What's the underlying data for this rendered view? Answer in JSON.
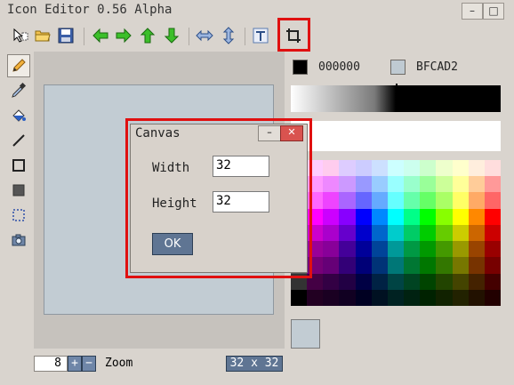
{
  "window": {
    "title": "Icon Editor 0.56 Alpha",
    "min_label": "–",
    "max_label": "□",
    "close_label": "✕"
  },
  "toolbar": {
    "icons": [
      "select-icon",
      "open-folder-icon",
      "save-icon",
      "arrow-left-icon",
      "arrow-right-icon",
      "arrow-up-icon",
      "arrow-down-icon",
      "flip-horizontal-icon",
      "flip-vertical-icon",
      "text-icon",
      "crop-icon"
    ]
  },
  "tools": [
    "pencil-icon",
    "eyedropper-icon",
    "fill-bucket-icon",
    "line-icon",
    "rectangle-outline-icon",
    "rectangle-filled-icon",
    "selection-icon",
    "camera-icon"
  ],
  "colors": {
    "primary_hex": "000000",
    "primary_color": "#000000",
    "secondary_hex": "BFCAD2",
    "secondary_color": "#bfcad2"
  },
  "zoom": {
    "value": "8",
    "plus": "+",
    "minus": "−",
    "label": "Zoom",
    "size_readout": "32 x 32"
  },
  "dialog": {
    "title": "Canvas",
    "min_label": "–",
    "close_label": "✕",
    "width_label": "Width",
    "width_value": "32",
    "height_label": "Height",
    "height_value": "32",
    "ok_label": "OK"
  },
  "palette": [
    [
      "#ffffff",
      "#ffccff",
      "#ffccee",
      "#ddccff",
      "#ccccff",
      "#cce0ff",
      "#ccffff",
      "#ccffee",
      "#ccffcc",
      "#eeffcc",
      "#ffffcc",
      "#ffeedd",
      "#ffdddd"
    ],
    [
      "#ffe0ff",
      "#ff99ff",
      "#ee88ff",
      "#cc99ff",
      "#9999ff",
      "#99ccff",
      "#99ffff",
      "#99ffcc",
      "#99ff99",
      "#ccff99",
      "#ffff99",
      "#ffcc99",
      "#ff9999"
    ],
    [
      "#dddddd",
      "#ff66ff",
      "#ee44ff",
      "#aa66ff",
      "#6666ff",
      "#66aaff",
      "#66ffff",
      "#66ffaa",
      "#66ff66",
      "#aaff66",
      "#ffff66",
      "#ffaa66",
      "#ff6666"
    ],
    [
      "#bbbbbb",
      "#ff00ff",
      "#cc00ff",
      "#8800ff",
      "#0000ff",
      "#0088ff",
      "#00ffff",
      "#00ff88",
      "#00ff00",
      "#88ff00",
      "#ffff00",
      "#ff8800",
      "#ff0000"
    ],
    [
      "#999999",
      "#cc00cc",
      "#aa00cc",
      "#6600cc",
      "#0000cc",
      "#0066cc",
      "#00cccc",
      "#00cc66",
      "#00cc00",
      "#66cc00",
      "#cccc00",
      "#cc6600",
      "#cc0000"
    ],
    [
      "#777777",
      "#990099",
      "#880099",
      "#440099",
      "#000099",
      "#004499",
      "#009999",
      "#009944",
      "#009900",
      "#449900",
      "#999900",
      "#994400",
      "#990000"
    ],
    [
      "#555555",
      "#770077",
      "#660077",
      "#330077",
      "#000077",
      "#003377",
      "#007777",
      "#007733",
      "#007700",
      "#337700",
      "#777700",
      "#773300",
      "#770000"
    ],
    [
      "#333333",
      "#440044",
      "#330044",
      "#220044",
      "#000044",
      "#002244",
      "#004444",
      "#004422",
      "#004400",
      "#224400",
      "#444400",
      "#442200",
      "#440000"
    ],
    [
      "#000000",
      "#220022",
      "#1a0022",
      "#110022",
      "#000022",
      "#001122",
      "#002222",
      "#002211",
      "#002200",
      "#112200",
      "#222200",
      "#221100",
      "#220000"
    ]
  ]
}
